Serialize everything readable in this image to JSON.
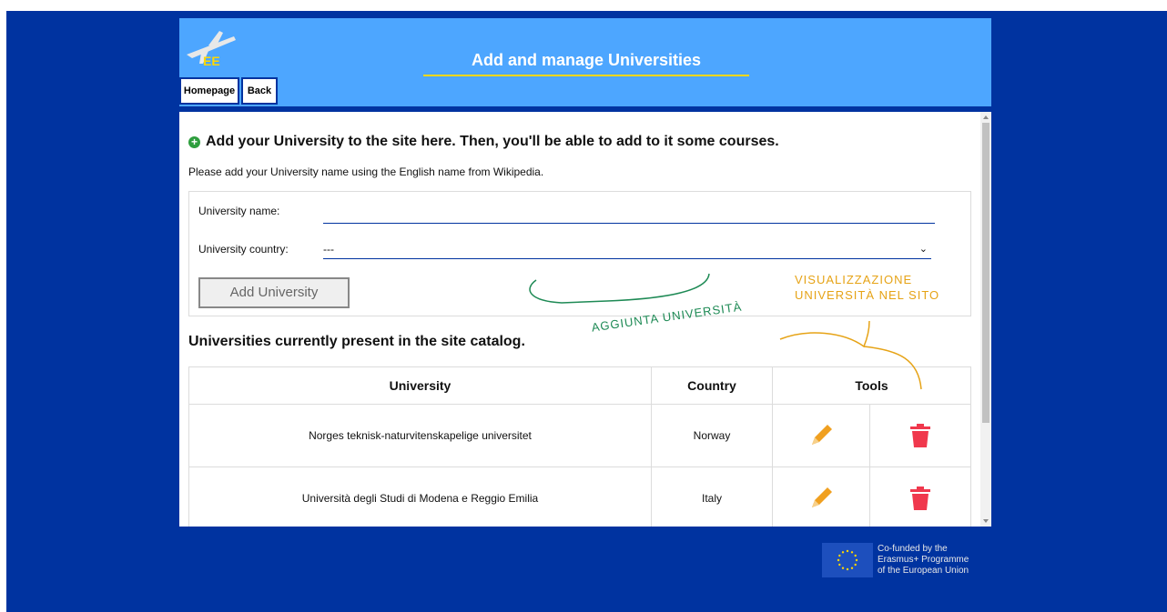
{
  "header": {
    "title": "Add and manage Universities",
    "logo_text": "EE",
    "nav": [
      {
        "label": "Homepage"
      },
      {
        "label": "Back"
      }
    ]
  },
  "add_section": {
    "title": "Add your University to the site here. Then, you'll be able to add to it some courses.",
    "note": "Please add your University name using the English name from Wikipedia.",
    "name_label": "University name:",
    "name_value": "",
    "country_label": "University country:",
    "country_selected": "---",
    "submit_label": "Add University"
  },
  "list_section": {
    "title": "Universities currently present in the site catalog.",
    "columns": [
      "University",
      "Country",
      "Tools"
    ],
    "rows": [
      {
        "university": "Norges teknisk-naturvitenskapelige universitet",
        "country": "Norway"
      },
      {
        "university": "Università degli Studi di Modena e Reggio Emilia",
        "country": "Italy"
      }
    ]
  },
  "annotations": {
    "green": "AGGIUNTA UNIVERSITÀ",
    "orange_line1": "VISUALIZZAZIONE",
    "orange_line2": "UNIVERSITÀ NEL SITO"
  },
  "footer": {
    "line1": "Co-funded by the",
    "line2": "Erasmus+ Programme",
    "line3": "of the European Union"
  },
  "colors": {
    "background": "#0033a0",
    "header": "#4da6ff",
    "accent_underline": "#ffd700",
    "edit_icon": "#f0a020",
    "delete_icon": "#f0384d"
  }
}
